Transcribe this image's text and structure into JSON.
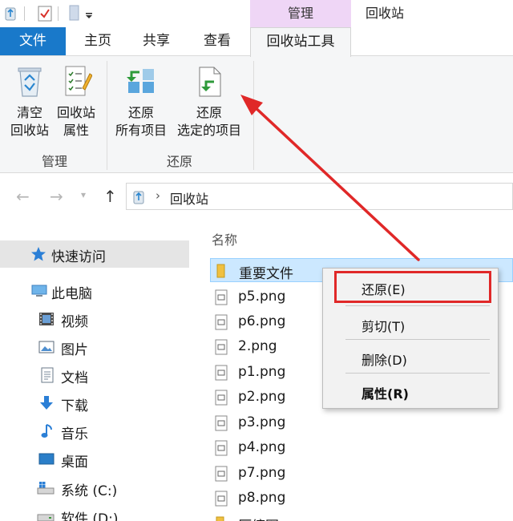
{
  "titlebar": {
    "context_header": "管理",
    "window_title": "回收站"
  },
  "tabs": {
    "file": "文件",
    "home": "主页",
    "share": "共享",
    "view": "查看",
    "tools": "回收站工具"
  },
  "ribbon": {
    "empty_line1": "清空",
    "empty_line2": "回收站",
    "props_line1": "回收站",
    "props_line2": "属性",
    "restore_all_line1": "还原",
    "restore_all_line2": "所有项目",
    "restore_sel_line1": "还原",
    "restore_sel_line2": "选定的项目",
    "group_manage": "管理",
    "group_restore": "还原"
  },
  "address": {
    "location": "回收站"
  },
  "nav": {
    "quick_access": "快速访问",
    "this_pc": "此电脑",
    "videos": "视频",
    "pictures": "图片",
    "documents": "文档",
    "downloads": "下载",
    "music": "音乐",
    "desktop": "桌面",
    "system_drive": "系统 (C:)",
    "software_drive": "软件 (D:)"
  },
  "filelist": {
    "column_name": "名称",
    "files": [
      "重要文件",
      "p5.png",
      "p6.png",
      "2.png",
      "p1.png",
      "p2.png",
      "p3.png",
      "p4.png",
      "p7.png",
      "p8.png",
      "压缩图"
    ]
  },
  "context_menu": {
    "restore": "还原(E)",
    "cut": "剪切(T)",
    "delete": "删除(D)",
    "properties": "属性(R)"
  },
  "colors": {
    "file_tab": "#1979ca",
    "context_tab": "#efd6f6",
    "annotation_red": "#e02828",
    "selection": "#cce8ff"
  }
}
